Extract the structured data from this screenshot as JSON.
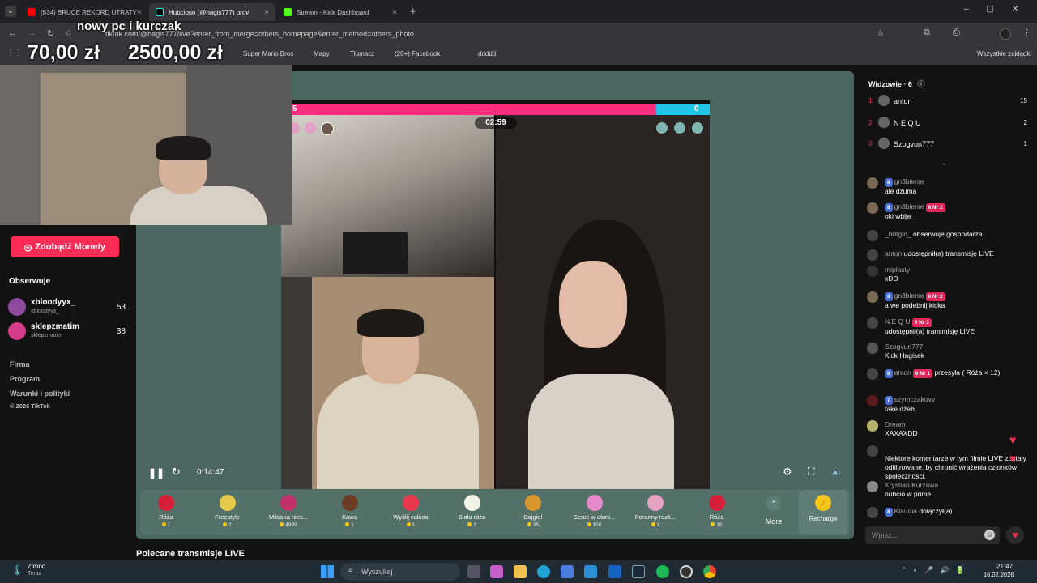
{
  "tabs": [
    {
      "title": "(834) BRUCE REKORD UTRATY",
      "color": "#ff0000"
    },
    {
      "title": "Hubcioso (@hagis777) prov",
      "color": "#000000"
    },
    {
      "title": "Stream - Kick Dashboard",
      "color": "#53fc18"
    }
  ],
  "address": {
    "url": "tiktok.com/@hagis777/live?enter_from_merge=others_homepage&enter_method=others_photo"
  },
  "bookmarks": [
    "Super Mario Bros",
    "Mapy",
    "Tłumacz",
    "(20+) Facebook",
    "ddddd",
    "Wszystkie zakładki"
  ],
  "overlay": {
    "title": "nowy pc i kurczak",
    "amount1": "70,00 zł",
    "amount2": "2500,00 zł"
  },
  "sidebar": {
    "coins_button": "Zdobądź Monety",
    "following_heading": "Obserwuje",
    "following": [
      {
        "name": "xbloodyyx_",
        "handle": "xbloodyyx_",
        "count": "53"
      },
      {
        "name": "sklepzmatim",
        "handle": "sklepzmatim",
        "count": "38"
      }
    ],
    "links": [
      "Firma",
      "Program",
      "Warunki i polityki",
      "© 2026 TikTok"
    ]
  },
  "battle": {
    "timer": "02:59",
    "score_left": "5",
    "score_right": "0"
  },
  "player": {
    "time": "0:14:47"
  },
  "gifts": [
    {
      "name": "Róża",
      "price": "1",
      "color": "#d6203a"
    },
    {
      "name": "Freestyle",
      "price": "1",
      "color": "#e6c84a"
    },
    {
      "name": "Miłosna nies...",
      "price": "4999",
      "color": "#c0306a"
    },
    {
      "name": "Kawa",
      "price": "1",
      "color": "#6b3b24"
    },
    {
      "name": "Wyślij całusa",
      "price": "1",
      "color": "#e8394d"
    },
    {
      "name": "Biała róża",
      "price": "1",
      "color": "#f2f2e6"
    },
    {
      "name": "Bajgiel",
      "price": "35",
      "color": "#d9962d"
    },
    {
      "name": "Serce w dłoni...",
      "price": "100",
      "color": "#e58ac9"
    },
    {
      "name": "Poranny rozk...",
      "price": "1",
      "color": "#e7a2c2"
    },
    {
      "name": "Róża",
      "price": "10",
      "color": "#d6203a"
    }
  ],
  "gift_more": "More",
  "recharge": "Recharge",
  "recommended": "Polecane transmisje LIVE",
  "chat": {
    "viewers_label": "Widzowie · 6",
    "viewers": [
      {
        "rank": "1",
        "name": "anton",
        "score": "15"
      },
      {
        "rank": "2",
        "name": "N E Q U",
        "score": "2"
      },
      {
        "rank": "3",
        "name": "Szogvun777",
        "score": "1"
      }
    ],
    "messages": [
      {
        "level": "8",
        "user": "gn3bienie",
        "fan": "",
        "text": "ale dżuma"
      },
      {
        "level": "8",
        "user": "gn3bienie",
        "fan": "6 Nr 2",
        "text": "oki wbije"
      },
      {
        "level": "",
        "user": "_h0tgirl_",
        "fan": "",
        "text": "obserwuje gospodarza"
      },
      {
        "level": "",
        "user": "anton",
        "fan": "",
        "text": "udostępnił(a) transmisję LIVE"
      },
      {
        "level": "",
        "user": "miplasty",
        "fan": "",
        "text": "xDD"
      },
      {
        "level": "8",
        "user": "gn3bienie",
        "fan": "6 Nr 2",
        "text": "a we podebnij kicka"
      },
      {
        "level": "",
        "user": "N E Q U",
        "fan": "6 Nr 3",
        "text": "udostępnił(a) transmisję LIVE"
      },
      {
        "level": "",
        "user": "Szogvun777",
        "fan": "",
        "text": "Kick Hagisek"
      },
      {
        "level": "8",
        "user": "anton",
        "fan": "6 Nr 1",
        "text": "przesyła ( Róża × 12)"
      },
      {
        "level": "7",
        "user": "szymczakovv",
        "fan": "",
        "text": "fake dżab"
      },
      {
        "level": "",
        "user": "Dream",
        "fan": "",
        "text": "XAXAXDD"
      },
      {
        "level": "",
        "user": "",
        "fan": "",
        "text": "Niektóre komentarze w tym filmie LIVE zostały odfiltrowane, by chronić wrażenia członków społeczności."
      },
      {
        "level": "",
        "user": "Krystian Kurzawa",
        "fan": "",
        "text": "hubcio w prime"
      },
      {
        "level": "8",
        "user": "Klaudia",
        "fan": "",
        "text": "dołączył(a)"
      }
    ],
    "input_placeholder": "Wpisz..."
  },
  "taskbar": {
    "weather": "Zimno",
    "weather_sub": "Teraz",
    "search": "Wyszukaj",
    "time": "21:47",
    "date": "16.02.2026"
  }
}
